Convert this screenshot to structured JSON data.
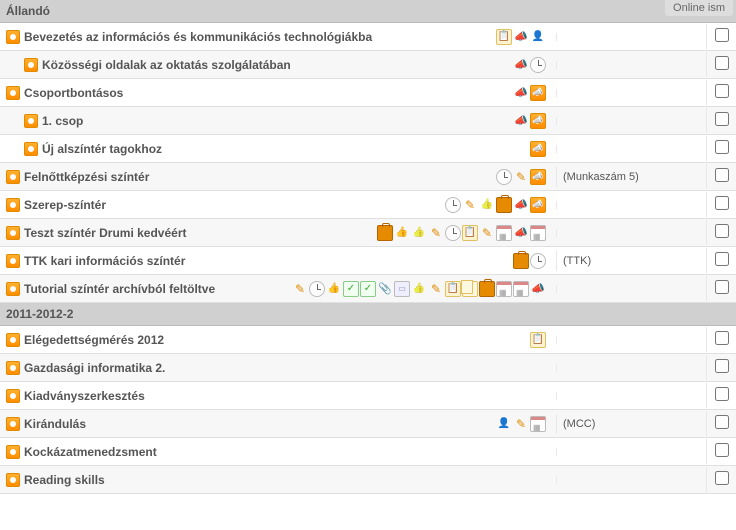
{
  "top_tab": "Online ism",
  "sections": [
    {
      "title": "Állandó",
      "rows": [
        {
          "title": "Bevezetés az információs és kommunikációs technológiákba",
          "indent": 0,
          "icons": [
            "clipboard",
            "horn-plain",
            "person"
          ],
          "meta": "",
          "alt": false
        },
        {
          "title": "Közösségi oldalak az oktatás szolgálatában",
          "indent": 1,
          "icons": [
            "horn-plain",
            "clock"
          ],
          "meta": "",
          "alt": true
        },
        {
          "title": "Csoportbontásos",
          "indent": 0,
          "icons": [
            "horn-plain",
            "horn"
          ],
          "meta": "",
          "alt": false
        },
        {
          "title": "1. csop",
          "indent": 1,
          "icons": [
            "horn-plain",
            "horn"
          ],
          "meta": "",
          "alt": true
        },
        {
          "title": "Új alszíntér tagokhoz",
          "indent": 1,
          "icons": [
            "horn"
          ],
          "meta": "",
          "alt": false
        },
        {
          "title": "Felnőttképzési színtér",
          "indent": 0,
          "icons": [
            "clock",
            "pencil",
            "horn"
          ],
          "meta": "(Munkaszám 5)",
          "alt": true
        },
        {
          "title": "Szerep-színtér",
          "indent": 0,
          "icons": [
            "clock",
            "pencil",
            "thumb-y",
            "brief",
            "horn-plain",
            "horn"
          ],
          "meta": "",
          "alt": false
        },
        {
          "title": "Teszt színtér Drumi kedvéért",
          "indent": 0,
          "icons": [
            "brief",
            "thumb",
            "thumb-y",
            "pencil",
            "clock",
            "clipboard",
            "pencil",
            "cal",
            "horn-plain",
            "cal"
          ],
          "meta": "",
          "alt": true
        },
        {
          "title": "TTK kari információs színtér",
          "indent": 0,
          "icons": [
            "brief",
            "clock"
          ],
          "meta": "(TTK)",
          "alt": false
        },
        {
          "title": "Tutorial színtér archívból feltöltve",
          "indent": 0,
          "icons": [
            "pencil",
            "clock",
            "thumb",
            "check-g",
            "check-g",
            "clip",
            "book",
            "thumb-y",
            "pencil",
            "clipboard",
            "copy",
            "brief",
            "cal",
            "cal",
            "horn-plain"
          ],
          "meta": "",
          "alt": true
        }
      ]
    },
    {
      "title": "2011-2012-2",
      "rows": [
        {
          "title": "Elégedettségmérés 2012",
          "indent": 0,
          "icons": [
            "clipboard"
          ],
          "meta": "",
          "alt": false
        },
        {
          "title": "Gazdasági informatika 2.",
          "indent": 0,
          "icons": [],
          "meta": "",
          "alt": true
        },
        {
          "title": "Kiadványszerkesztés",
          "indent": 0,
          "icons": [],
          "meta": "",
          "alt": false
        },
        {
          "title": "Kirándulás",
          "indent": 0,
          "icons": [
            "person",
            "pencil",
            "cal"
          ],
          "meta": "(MCC)",
          "alt": true
        },
        {
          "title": "Kockázatmenedzsment",
          "indent": 0,
          "icons": [],
          "meta": "",
          "alt": false
        },
        {
          "title": "Reading skills",
          "indent": 0,
          "icons": [],
          "meta": "",
          "alt": true
        }
      ]
    }
  ]
}
